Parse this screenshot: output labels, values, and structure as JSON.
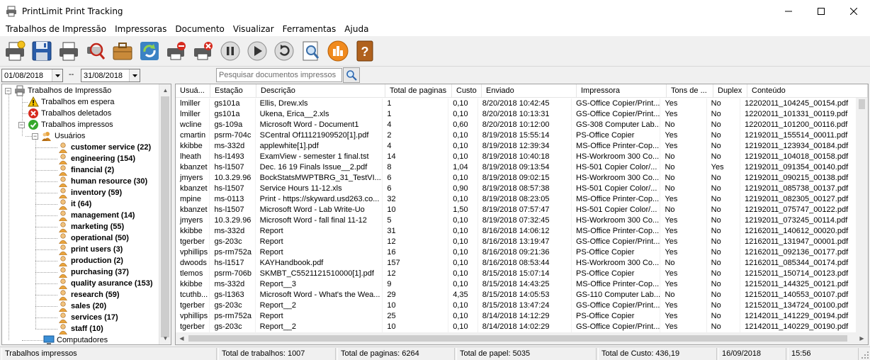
{
  "window": {
    "title": "PrintLimit Print Tracking"
  },
  "menu": [
    "Trabalhos de Impressão",
    "Impressoras",
    "Documento",
    "Visualizar",
    "Ferramentas",
    "Ajuda"
  ],
  "toolbar": [
    {
      "name": "printer-new-icon"
    },
    {
      "name": "save-icon"
    },
    {
      "name": "printer-icon"
    },
    {
      "name": "magnifier-printer-icon"
    },
    {
      "name": "briefcase-icon"
    },
    {
      "name": "refresh-icon"
    },
    {
      "name": "printer-stop-icon"
    },
    {
      "name": "printer-delete-icon"
    },
    {
      "name": "pause-icon"
    },
    {
      "name": "play-icon"
    },
    {
      "name": "restart-icon"
    },
    {
      "name": "print-preview-icon"
    },
    {
      "name": "chart-icon"
    },
    {
      "name": "help-book-icon"
    }
  ],
  "filter": {
    "date_from": "01/08/2018",
    "separator": "--",
    "date_to": "31/08/2018",
    "search_placeholder": "Pesquisar documentos impressos"
  },
  "tree": {
    "root": "Trabalhos de Impressão",
    "waiting": "Trabalhos em espera",
    "deleted": "Trabalhos deletados",
    "printed": "Trabalhos impressos",
    "users": "Usuários",
    "groups": [
      "customer service (22)",
      "engineering (154)",
      "financial (2)",
      "human resource (30)",
      "inventory (59)",
      "it (64)",
      "management (14)",
      "marketing (55)",
      "operational (50)",
      "print users (3)",
      "production (2)",
      "purchasing (37)",
      "quality asurance (153)",
      "research (59)",
      "sales (20)",
      "services (17)",
      "staff (10)"
    ],
    "computers": "Computadores"
  },
  "table": {
    "columns": [
      "Usuá...",
      "Estação",
      "Descrição",
      "Total de paginas",
      "Custo",
      "Enviado",
      "Impressora",
      "Tons de ...",
      "Duplex",
      "Conteúdo"
    ],
    "rows": [
      [
        "lmiller",
        "gs101a",
        "Ellis, Drew.xls",
        "1",
        "0,10",
        "8/20/2018 10:42:45",
        "GS-Office Copier/Print...",
        "Yes",
        "No",
        "12202011_104245_00154.pdf"
      ],
      [
        "lmiller",
        "gs101a",
        "Ukena, Erica__2.xls",
        "1",
        "0,10",
        "8/20/2018 10:13:31",
        "GS-Office Copier/Print...",
        "Yes",
        "No",
        "12202011_101331_00119.pdf"
      ],
      [
        "wcline",
        "gs-109a",
        "Microsoft Word - Document1",
        "4",
        "0,60",
        "8/20/2018 10:12:00",
        "GS-308 Computer Lab...",
        "No",
        "No",
        "12202011_101200_00116.pdf"
      ],
      [
        "cmartin",
        "psrm-704c",
        "SCentral Of11121909520[1].pdf",
        "2",
        "0,10",
        "8/19/2018 15:55:14",
        "PS-Office Copier",
        "Yes",
        "No",
        "12192011_155514_00011.pdf"
      ],
      [
        "kkibbe",
        "ms-332d",
        "applewhite[1].pdf",
        "4",
        "0,10",
        "8/19/2018 12:39:34",
        "MS-Office Printer-Cop...",
        "Yes",
        "No",
        "12192011_123934_00184.pdf"
      ],
      [
        "lheath",
        "hs-l1493",
        "ExamView - semester 1 final.tst",
        "14",
        "0,10",
        "8/19/2018 10:40:18",
        "HS-Workroom 300 Co...",
        "No",
        "No",
        "12192011_104018_00158.pdf"
      ],
      [
        "kbanzet",
        "hs-l1507",
        "Dec. 16  19 Finals Issue__2.pdf",
        "8",
        "1,04",
        "8/19/2018 09:13:54",
        "HS-501 Copier Color/...",
        "No",
        "Yes",
        "12192011_091354_00140.pdf"
      ],
      [
        "jmyers",
        "10.3.29.96",
        "BockStatsMWPTBRG_31_TestVI....",
        "6",
        "0,10",
        "8/19/2018 09:02:15",
        "HS-Workroom 300 Co...",
        "No",
        "No",
        "12192011_090215_00138.pdf"
      ],
      [
        "kbanzet",
        "hs-l1507",
        "Service Hours 11-12.xls",
        "6",
        "0,90",
        "8/19/2018 08:57:38",
        "HS-501 Copier Color/...",
        "No",
        "No",
        "12192011_085738_00137.pdf"
      ],
      [
        "mpine",
        "ms-0113",
        "Print - https://skyward.usd263.co...",
        "32",
        "0,10",
        "8/19/2018 08:23:05",
        "MS-Office Printer-Cop...",
        "Yes",
        "No",
        "12192011_082305_00127.pdf"
      ],
      [
        "kbanzet",
        "hs-l1507",
        "Microsoft Word - Lab Write-Uo",
        "10",
        "1,50",
        "8/19/2018 07:57:47",
        "HS-501 Copier Color/...",
        "No",
        "No",
        "12192011_075747_00122.pdf"
      ],
      [
        "jmyers",
        "10.3.29.96",
        "Microsoft Word - fall final 11-12",
        "5",
        "0,10",
        "8/19/2018 07:32:45",
        "HS-Workroom 300 Co...",
        "Yes",
        "No",
        "12192011_073245_00114.pdf"
      ],
      [
        "kkibbe",
        "ms-332d",
        "Report",
        "31",
        "0,10",
        "8/16/2018 14:06:12",
        "MS-Office Printer-Cop...",
        "Yes",
        "No",
        "12162011_140612_00020.pdf"
      ],
      [
        "tgerber",
        "gs-203c",
        "Report",
        "12",
        "0,10",
        "8/16/2018 13:19:47",
        "GS-Office Copier/Print...",
        "Yes",
        "No",
        "12162011_131947_00001.pdf"
      ],
      [
        "vphillips",
        "ps-rm752a",
        "Report",
        "16",
        "0,10",
        "8/16/2018 09:21:36",
        "PS-Office Copier",
        "Yes",
        "No",
        "12162011_092136_00177.pdf"
      ],
      [
        "dwoods",
        "hs-l1517",
        "KAYHandbook.pdf",
        "157",
        "0,10",
        "8/16/2018 08:53:44",
        "HS-Workroom 300 Co...",
        "No",
        "No",
        "12162011_085344_00174.pdf"
      ],
      [
        "tlemos",
        "psrm-706b",
        "SKMBT_C5521121510000[1].pdf",
        "12",
        "0,10",
        "8/15/2018 15:07:14",
        "PS-Office Copier",
        "Yes",
        "No",
        "12152011_150714_00123.pdf"
      ],
      [
        "kkibbe",
        "ms-332d",
        "Report__3",
        "9",
        "0,10",
        "8/15/2018 14:43:25",
        "MS-Office Printer-Cop...",
        "Yes",
        "No",
        "12152011_144325_00121.pdf"
      ],
      [
        "tcuthb...",
        "gs-l1363",
        "Microsoft Word - What's the Wea...",
        "29",
        "4,35",
        "8/15/2018 14:05:53",
        "GS-110 Computer Lab...",
        "No",
        "No",
        "12152011_140553_00107.pdf"
      ],
      [
        "tgerber",
        "gs-203c",
        "Report__2",
        "10",
        "0,10",
        "8/15/2018 13:47:24",
        "GS-Office Copier/Print...",
        "Yes",
        "No",
        "12152011_134724_00100.pdf"
      ],
      [
        "vphillips",
        "ps-rm752a",
        "Report",
        "25",
        "0,10",
        "8/14/2018 14:12:29",
        "PS-Office Copier",
        "Yes",
        "No",
        "12142011_141229_00194.pdf"
      ],
      [
        "tgerber",
        "gs-203c",
        "Report__2",
        "10",
        "0,10",
        "8/14/2018 14:02:29",
        "GS-Office Copier/Print...",
        "Yes",
        "No",
        "12142011_140229_00190.pdf"
      ]
    ]
  },
  "status": {
    "section": "Trabalhos impressos",
    "total_jobs": "Total de trabalhos: 1007",
    "total_pages": "Total de paginas: 6264",
    "total_paper": "Total de papel: 5035",
    "total_cost": "Total de Custo: 436,19",
    "date": "16/09/2018",
    "time": "15:56"
  },
  "colors": {
    "warning": "#f5c400",
    "error": "#d62a1e",
    "success": "#36a82c",
    "user": "#e8a33c"
  }
}
